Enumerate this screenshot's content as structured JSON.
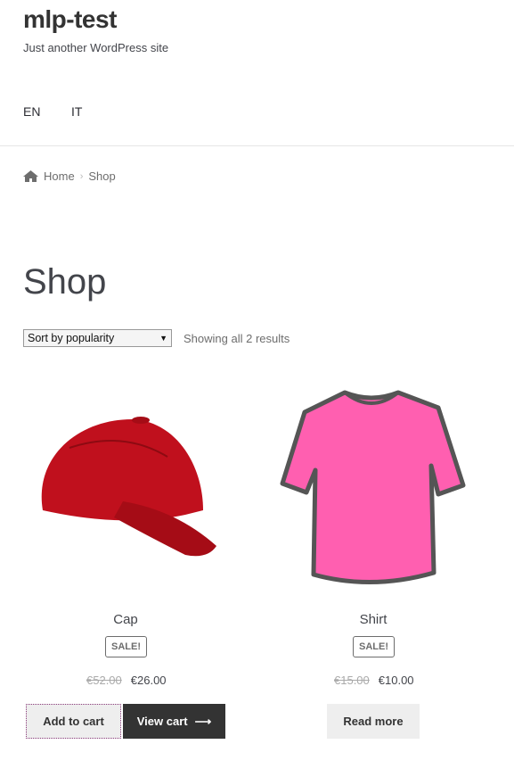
{
  "site": {
    "title": "mlp-test",
    "tagline": "Just another WordPress site"
  },
  "languages": [
    "EN",
    "IT"
  ],
  "breadcrumb": {
    "home": "Home",
    "current": "Shop"
  },
  "page_title": "Shop",
  "sort": {
    "selected": "Sort by popularity"
  },
  "result_count": "Showing all 2 results",
  "products": [
    {
      "name": "Cap",
      "badge": "SALE!",
      "old_price": "€52.00",
      "price": "€26.00",
      "buttons": [
        "Add to cart",
        "View cart"
      ]
    },
    {
      "name": "Shirt",
      "badge": "SALE!",
      "old_price": "€15.00",
      "price": "€10.00",
      "buttons": [
        "Read more"
      ]
    }
  ]
}
